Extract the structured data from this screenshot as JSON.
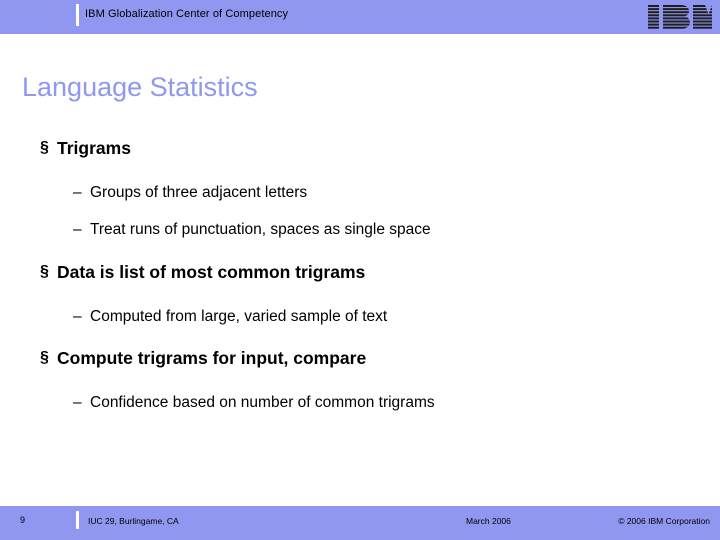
{
  "header": {
    "title": "IBM Globalization Center of Competency",
    "logo_icon": "ibm-logo-icon",
    "band_color": "#8f97f0"
  },
  "slide": {
    "title": "Language Statistics",
    "title_color": "#8f97f0",
    "bullets": [
      {
        "level": 1,
        "marker": "§",
        "text": "Trigrams"
      },
      {
        "level": 2,
        "marker": "–",
        "text": "Groups of three adjacent letters"
      },
      {
        "level": 2,
        "marker": "–",
        "text": "Treat runs of punctuation, spaces as single space"
      },
      {
        "level": 1,
        "marker": "§",
        "text": "Data is list of most common trigrams"
      },
      {
        "level": 2,
        "marker": "–",
        "text": "Computed from large, varied sample of text"
      },
      {
        "level": 1,
        "marker": "§",
        "text": "Compute trigrams for input, compare"
      },
      {
        "level": 2,
        "marker": "–",
        "text": "Confidence based on number of common trigrams"
      }
    ]
  },
  "footer": {
    "page_number": "9",
    "left": "IUC 29, Burlingame, CA",
    "center": "March 2006",
    "right": "© 2006 IBM Corporation",
    "band_color": "#8f97f0"
  }
}
